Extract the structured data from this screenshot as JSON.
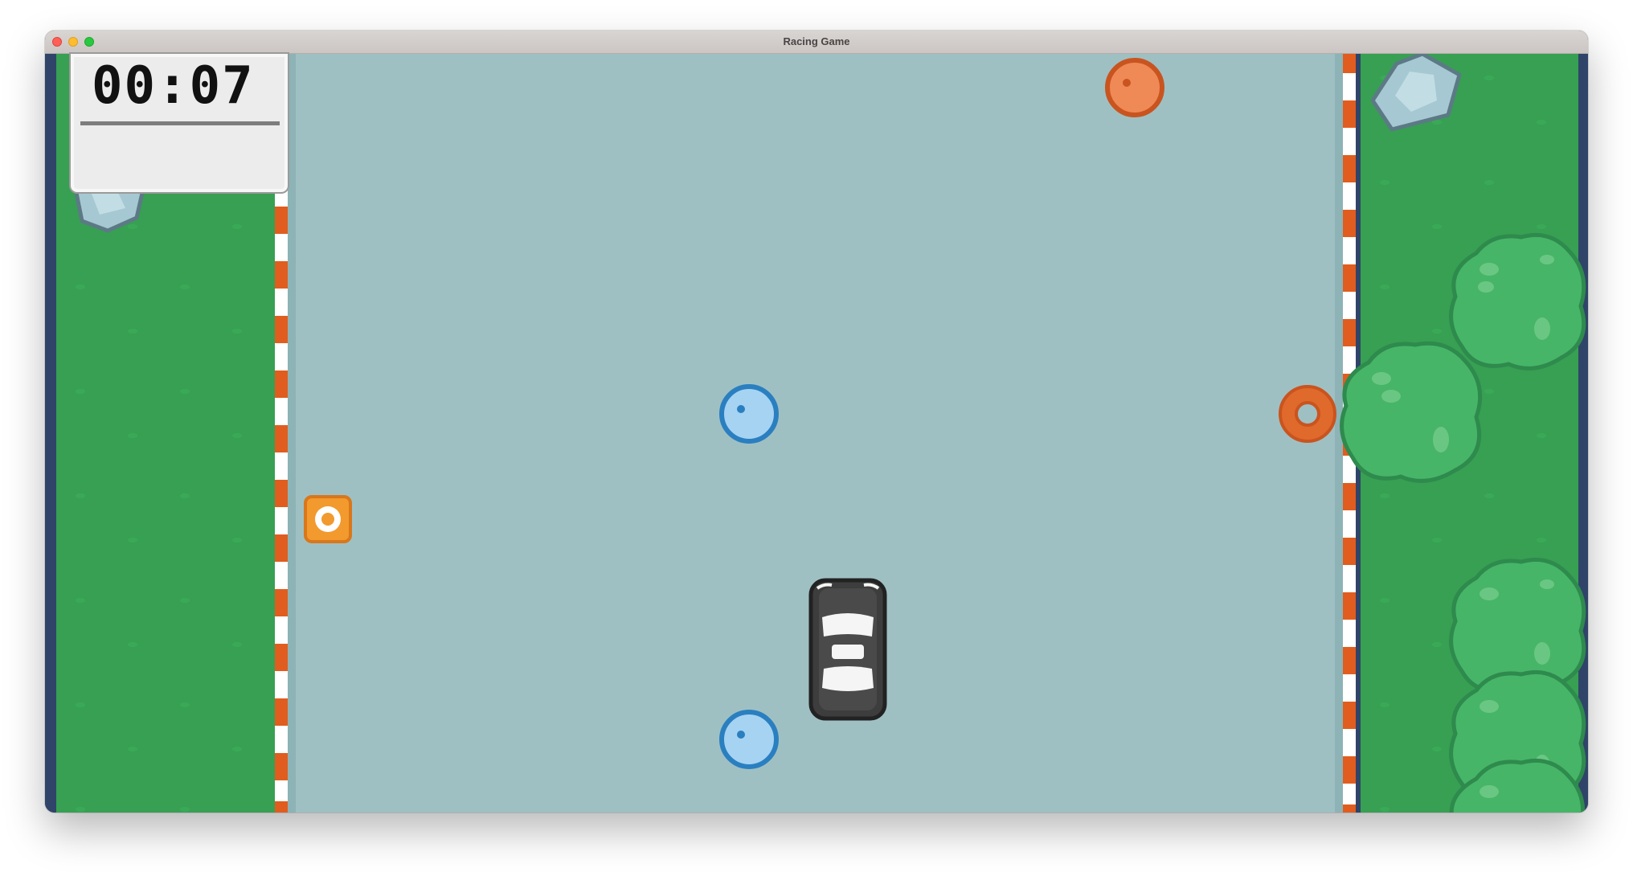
{
  "window": {
    "title": "Racing Game"
  },
  "hud": {
    "timer": "00:07",
    "panel_color": "#ececec"
  },
  "game": {
    "road_color": "#9fc0c3",
    "grass_color": "#37a052",
    "curb_colors": [
      "#e05d1f",
      "#ffffff"
    ],
    "player_car_color": "#3d3d3d",
    "objects": [
      {
        "type": "orange-orb",
        "lane": "right"
      },
      {
        "type": "blue-orb",
        "lane": "center"
      },
      {
        "type": "blue-orb",
        "lane": "center"
      },
      {
        "type": "orange-ring",
        "lane": "right-edge"
      },
      {
        "type": "orange-square-pickup",
        "lane": "left-edge"
      },
      {
        "type": "player-car",
        "lane": "center"
      }
    ],
    "scenery": [
      "rock",
      "rock",
      "bush",
      "bush",
      "bush",
      "bush",
      "bush"
    ]
  },
  "colors": {
    "orange": "#ef8a57",
    "orange_dark": "#c9541f",
    "blue": "#a6d3f2",
    "blue_dark": "#2a7fc0",
    "bush": "#46b567",
    "bush_dark": "#2e8a4d",
    "rock": "#a6c8d2",
    "rock_dark": "#5c7a86",
    "frame": "#2f4468"
  }
}
